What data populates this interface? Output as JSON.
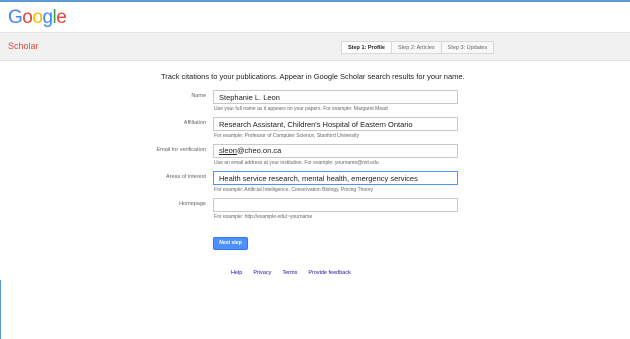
{
  "logo": [
    "G",
    "o",
    "o",
    "g",
    "l",
    "e"
  ],
  "colors": {
    "accent": "#4d90fe",
    "scholar_red": "#dd4b39",
    "link": "#1a0dab"
  },
  "subbar": {
    "section": "Scholar"
  },
  "steps": [
    "Step 1: Profile",
    "Step 2: Articles",
    "Step 3: Updates"
  ],
  "headline": "Track citations to your publications. Appear in Google Scholar search results for your name.",
  "form": {
    "name": {
      "label": "Name",
      "value": "Stephanie L. Leon",
      "hint": "Use your full name as it appears on your papers. For example: Margaret Mead"
    },
    "affiliation": {
      "label": "Affiliation",
      "value": "Research Assistant, Children's Hospital of Eastern Ontario",
      "hint": "For example: Professor of Computer Science, Stanford University"
    },
    "email": {
      "label": "Email for verification",
      "value_user": "sleon",
      "value_domain": "@cheo.on.ca",
      "hint": "Use an email address at your institution. For example: yourname@mit.edu"
    },
    "interests": {
      "label": "Areas of interest",
      "value": "Health service research, mental health, emergency services",
      "hint": "For example: Artificial Intelligence, Conservation Biology, Pricing Theory"
    },
    "homepage": {
      "label": "Homepage",
      "value": "",
      "hint": "For example: http://example.edu/~yourname"
    }
  },
  "next_button": "Next step",
  "footer": [
    "Help",
    "Privacy",
    "Terms",
    "Provide feedback"
  ]
}
